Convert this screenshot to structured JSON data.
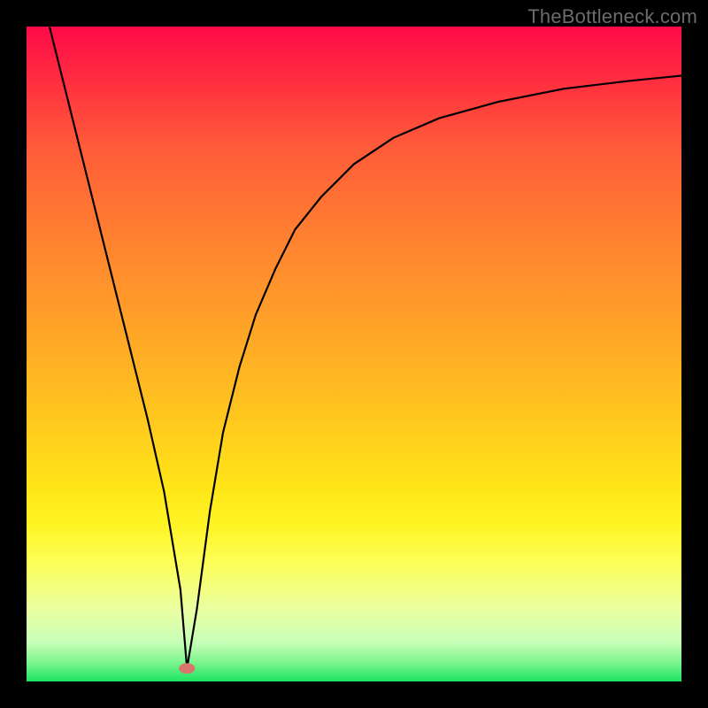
{
  "watermark": {
    "text": "TheBottleneck.com"
  },
  "chart_data": {
    "type": "line",
    "title": "",
    "xlabel": "",
    "ylabel": "",
    "xlim": [
      0,
      100
    ],
    "ylim": [
      0,
      100
    ],
    "grid": false,
    "legend": false,
    "marker": {
      "x": 24.5,
      "y": 2,
      "color": "#d9756b"
    },
    "series": [
      {
        "name": "bottleneck-curve",
        "x": [
          3.5,
          6.0,
          8.5,
          11.0,
          13.5,
          16.0,
          18.5,
          21.0,
          23.5,
          24.5,
          26.0,
          28.0,
          30.0,
          32.5,
          35.0,
          38.0,
          41.0,
          45.0,
          50.0,
          56.0,
          63.0,
          72.0,
          82.0,
          92.0,
          100.0
        ],
        "values": [
          100,
          90,
          80,
          70,
          60,
          50,
          40,
          29,
          14,
          2,
          11,
          26,
          38,
          48,
          56,
          63,
          69,
          74,
          79,
          83,
          86,
          88.5,
          90.5,
          91.7,
          92.5
        ]
      }
    ]
  }
}
